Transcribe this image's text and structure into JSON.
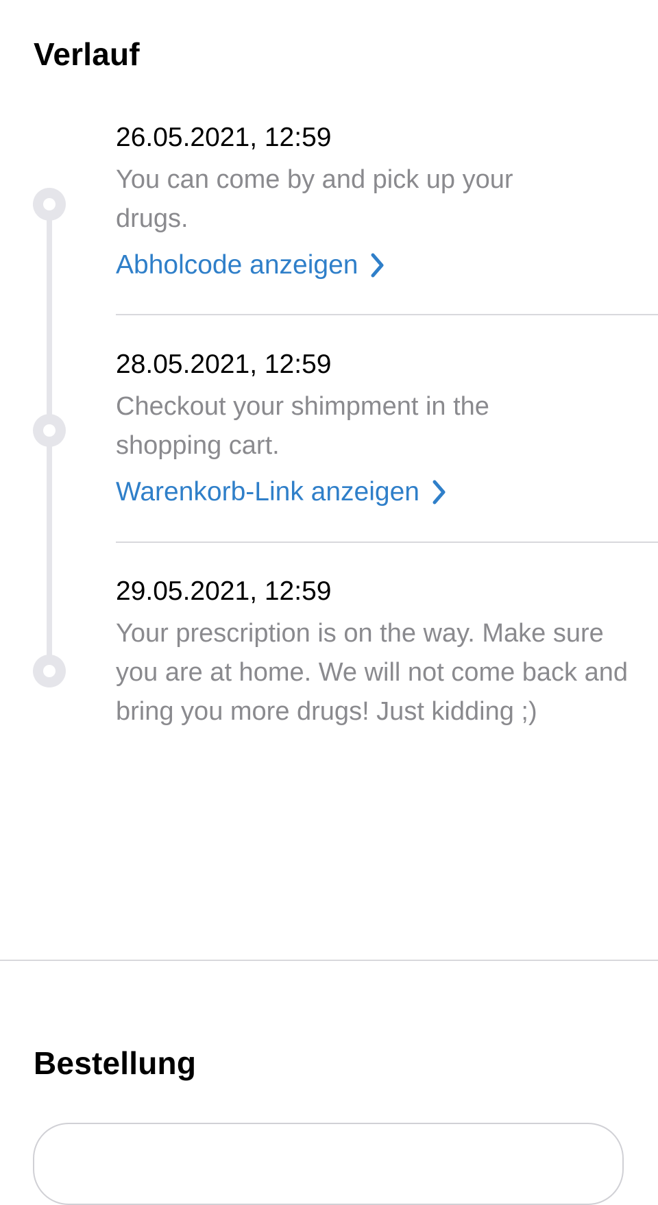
{
  "history": {
    "title": "Verlauf",
    "events": [
      {
        "date": "26.05.2021, 12:59",
        "text": "You can come by and pick up your drugs.",
        "link_label": "Abholcode anzeigen",
        "link_icon": "chevron-right-icon"
      },
      {
        "date": "28.05.2021, 12:59",
        "text": "Checkout your shimpment in the shopping cart.",
        "link_label": "Warenkorb-Link anzeigen",
        "link_icon": "chevron-right-icon"
      },
      {
        "date": "29.05.2021, 12:59",
        "text": "Your prescription is on the way. Make sure you are at home. We will not come back and bring you more drugs! Just kidding ;)"
      }
    ]
  },
  "order": {
    "title": "Bestellung"
  },
  "colors": {
    "link": "#2f7fc9",
    "secondary_text": "#8a8a8e",
    "timeline": "#e5e5ea",
    "divider": "#d8d8dc"
  }
}
